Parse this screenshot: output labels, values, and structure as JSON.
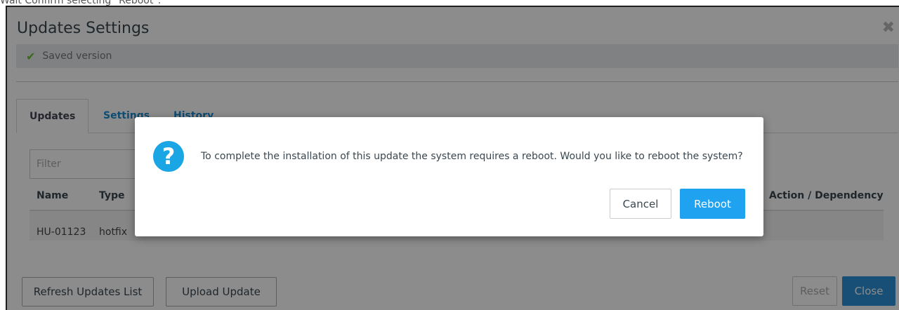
{
  "caption": "Wait Confirm selecting \"Reboot\".",
  "window": {
    "title": "Updates Settings",
    "close_icon": "close-icon"
  },
  "status": {
    "icon": "check-icon",
    "text": "Saved version",
    "color": "#6dbd35"
  },
  "tabs": [
    {
      "label": "Updates",
      "active": true
    },
    {
      "label": "Settings",
      "active": false
    },
    {
      "label": "History",
      "active": false
    }
  ],
  "filter": {
    "placeholder": "Filter",
    "value": ""
  },
  "table": {
    "columns": [
      "Name",
      "Type",
      "Action / Dependency"
    ],
    "rows": [
      {
        "name": "HU-01123",
        "type": "hotfix"
      }
    ]
  },
  "footer": {
    "refresh_label": "Refresh Updates List",
    "upload_label": "Upload Update",
    "reset_label": "Reset",
    "close_label": "Close"
  },
  "dialog": {
    "icon": "question-icon",
    "message": "To complete the installation of this update the system requires a reboot. Would you like to reboot the system?",
    "cancel_label": "Cancel",
    "reboot_label": "Reboot",
    "accent": "#1fa2f0"
  }
}
